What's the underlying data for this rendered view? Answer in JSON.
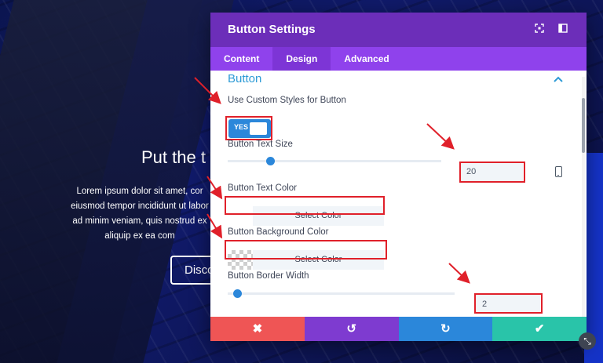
{
  "hero": {
    "title": "Put the t",
    "text_lines": [
      "Lorem ipsum dolor sit amet, cor",
      "eiusmod tempor incididunt ut labor",
      "ad minim veniam, quis nostrud ex",
      "aliquip ex ea com"
    ],
    "button_label": "Disco"
  },
  "modal": {
    "title": "Button Settings",
    "header_icons": [
      "expand-icon",
      "sidebar-layout-icon"
    ],
    "tabs": [
      {
        "label": "Content",
        "active": false
      },
      {
        "label": "Design",
        "active": true
      },
      {
        "label": "Advanced",
        "active": false
      }
    ],
    "section": {
      "title": "Button",
      "expanded": true
    },
    "fields": {
      "custom_styles": {
        "label": "Use Custom Styles for Button",
        "toggle_text": "YES",
        "value": true
      },
      "text_size": {
        "label": "Button Text Size",
        "value": "20",
        "slider_fraction": 0.2
      },
      "text_color": {
        "label": "Button Text Color",
        "button_label": "Select Color"
      },
      "background_color": {
        "label": "Button Background Color",
        "button_label": "Select Color"
      },
      "border_width": {
        "label": "Button Border Width",
        "value": "2",
        "slider_fraction": 0.02
      }
    },
    "footer": {
      "discard": "✖",
      "undo": "↺",
      "redo": "↻",
      "save": "✔"
    }
  },
  "colors": {
    "header": "#6c2eb9",
    "tabs": "#8f42ec",
    "accent_blue": "#2b87da",
    "highlight_red": "#e0202a",
    "discard": "#ef5555",
    "save": "#29c4a9"
  }
}
